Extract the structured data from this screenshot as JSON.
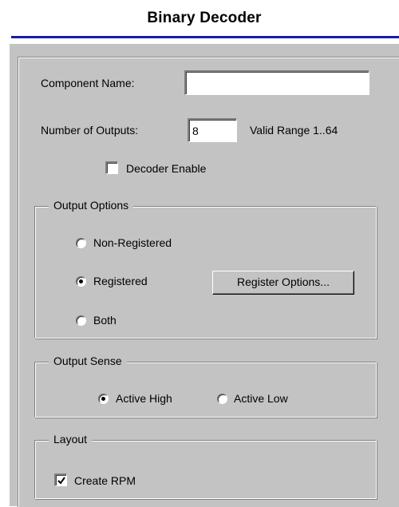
{
  "window": {
    "title": "Binary Decoder"
  },
  "component_name": {
    "label": "Component Name:",
    "value": ""
  },
  "number_of_outputs": {
    "label": "Number of Outputs:",
    "value": "8",
    "range_text": "Valid Range 1..64"
  },
  "decoder_enable": {
    "label": "Decoder Enable",
    "checked": false
  },
  "output_options": {
    "legend": "Output Options",
    "options": [
      {
        "label": "Non-Registered",
        "selected": false
      },
      {
        "label": "Registered",
        "selected": true
      },
      {
        "label": "Both",
        "selected": false
      }
    ],
    "register_button_label": "Register Options..."
  },
  "output_sense": {
    "legend": "Output Sense",
    "options": [
      {
        "label": "Active High",
        "selected": true
      },
      {
        "label": "Active Low",
        "selected": false
      }
    ]
  },
  "layout": {
    "legend": "Layout",
    "create_rpm": {
      "label": "Create RPM",
      "checked": true
    }
  }
}
